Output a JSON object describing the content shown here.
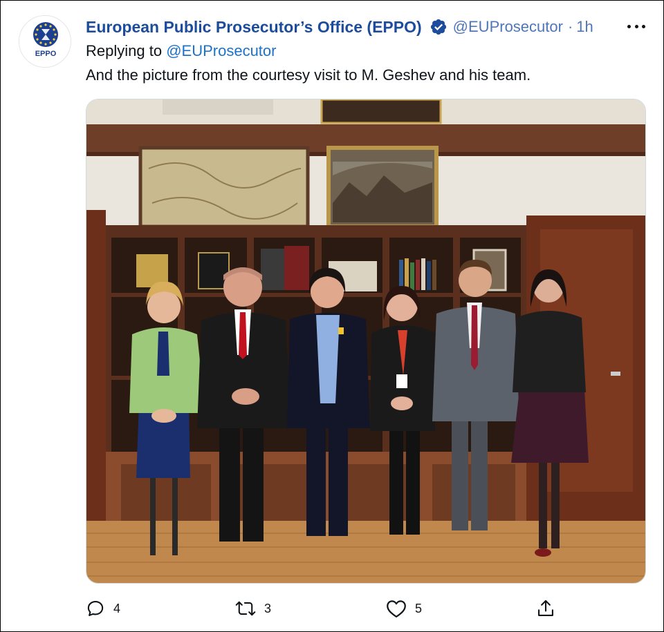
{
  "tweet": {
    "display_name": "European Public Prosecutor’s Office (EPPO)",
    "handle": "@EUProsecutor",
    "separator": "·",
    "time": "1h",
    "reply_prefix": "Replying to",
    "reply_to": "@EUProsecutor",
    "text": "And the picture from the courtesy visit to M. Geshev and his team.",
    "avatar_text": "EPPO",
    "verified": true
  },
  "actions": {
    "replies": "4",
    "retweets": "3",
    "likes": "5"
  },
  "icons": {
    "reply": "reply-icon",
    "retweet": "retweet-icon",
    "like": "heart-icon",
    "share": "share-icon",
    "more": "more-icon",
    "verified": "verified-badge-icon"
  },
  "colors": {
    "name": "#1d4c9c",
    "handle": "#4f76b8",
    "mention": "#1d72c9",
    "verified": "#1d4c9c"
  }
}
